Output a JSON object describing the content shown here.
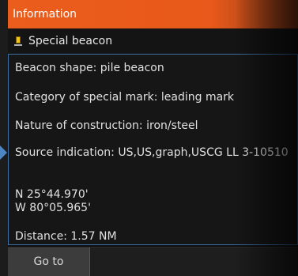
{
  "panel": {
    "title": "Information"
  },
  "object": {
    "name": "Special beacon",
    "icon": "beacon-icon"
  },
  "details": {
    "beacon_shape": "Beacon shape: pile beacon",
    "category": "Category of special mark: leading mark",
    "construction": "Nature of construction: iron/steel",
    "source": "Source indication: US,US,graph,USCG LL 3-10510",
    "latitude": "N  25°44.970'",
    "longitude": "W  80°05.965'",
    "distance": "Distance: 1.57 NM"
  },
  "actions": {
    "goto_label": "Go to"
  },
  "colors": {
    "title_bar": "#ea5d1c",
    "highlight_border": "#3f6fa3",
    "beacon_icon": "#f3c21a"
  }
}
